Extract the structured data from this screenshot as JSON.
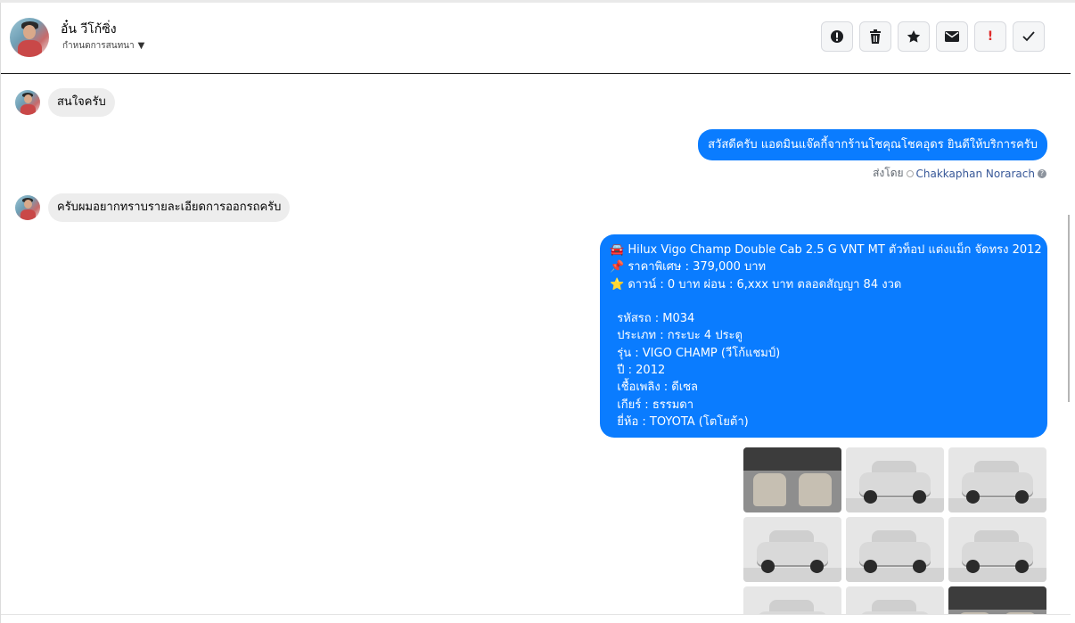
{
  "contact": {
    "name": "อั๋น วีโก้ซิ่ง",
    "status": "กำหนดการสนทนา"
  },
  "actions": [
    {
      "name": "spam-button",
      "icon": "alert-circle-icon",
      "glyph": "⏺"
    },
    {
      "name": "delete-button",
      "icon": "trash-icon",
      "glyph": "🗑"
    },
    {
      "name": "star-button",
      "icon": "star-icon",
      "glyph": "★"
    },
    {
      "name": "mark-unread-button",
      "icon": "envelope-icon",
      "glyph": "✉"
    },
    {
      "name": "follow-up-button",
      "icon": "exclamation-icon",
      "glyph": "!"
    },
    {
      "name": "done-button",
      "icon": "check-icon",
      "glyph": "✓"
    }
  ],
  "messages": {
    "m1": "สนใจครับ",
    "m2": "สวัสดีครับ แอดมินแจ๊คกี้จากร้านโชคุณโชคอุดร ยินดีให้บริการครับ",
    "sent_by_label": "ส่งโดย",
    "agent_name": "Chakkaphan Norarach",
    "m3": "ครับผมอยากทราบรายละเอียดการออกรถครับ",
    "listing": {
      "line1": "🚘 Hilux Vigo Champ Double Cab 2.5 G VNT MT ตัวท็อป แต่งแม็ก จัดทรง 2012",
      "line2": "📌 ราคาพิเศษ : 379,000 บาท",
      "line3": "⭐ ดาวน์ : 0 บาท ผ่อน : 6,xxx บาท ตลอดสัญญา 84 งวด",
      "line4": "  รหัสรถ : M034",
      "line5": "  ประเภท : กระบะ 4 ประตู",
      "line6": "  รุ่น : VIGO CHAMP (วีโก้แชมป์)",
      "line7": "  ปี : 2012",
      "line8": "  เชื้อเพลิง : ดีเซล",
      "line9": "  เกียร์ : ธรรมดา",
      "line10": "  ยี่ห้อ : TOYOTA (โตโยต้า)"
    }
  },
  "colors": {
    "accent": "#0a7cff",
    "incoming_bubble": "#ededed"
  }
}
